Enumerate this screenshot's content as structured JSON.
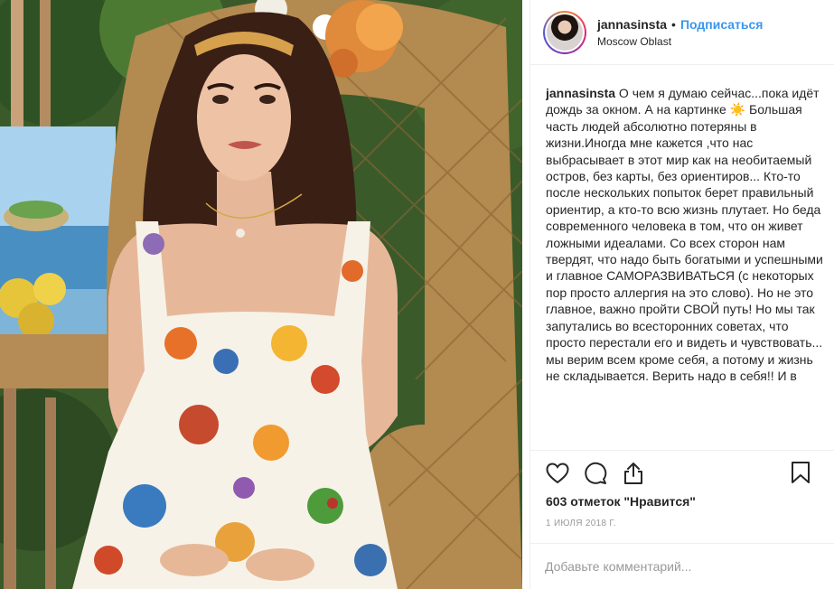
{
  "post": {
    "username": "jannasinsta",
    "separator": "•",
    "follow_label": "Подписаться",
    "location": "Moscow Oblast"
  },
  "caption": {
    "username": "jannasinsta",
    "text": "О чем я думаю сейчас...пока идёт дождь за окном. А на картинке ☀️ Большая часть людей абсолютно потеряны в жизни.Иногда мне кажется ,что нас выбрасывает в этот мир как на необитаемый остров, без карты, без ориентиров... Кто-то после нескольких попыток берет правильный ориентир, а кто-то всю жизнь плутает. Но беда современного человека в том, что он живет ложными идеалами. Со всех сторон нам твердят, что надо быть богатыми и успешными и главное САМОРАЗВИВАТЬСЯ (с некоторых пор просто аллергия на это слово). Но не это главное, важно пройти СВОЙ путь! Но мы так запутались во всесторонних советах, что просто перестали его и видеть и чувствовать... мы верим всем кроме себя, а потому и жизнь не складывается. Верить надо в себя!! И в"
  },
  "likes_text": "603 отметок \"Нравится\"",
  "date_text": "1 ИЮЛЯ 2018 Г.",
  "comment": {
    "placeholder": "Добавьте комментарий..."
  },
  "icons": {
    "like": "heart-icon",
    "comment": "comment-bubble-icon",
    "share": "share-icon",
    "save": "bookmark-icon"
  },
  "colors": {
    "accent": "#3897f0",
    "text": "#262626",
    "muted": "#999999",
    "border": "#efefef"
  }
}
